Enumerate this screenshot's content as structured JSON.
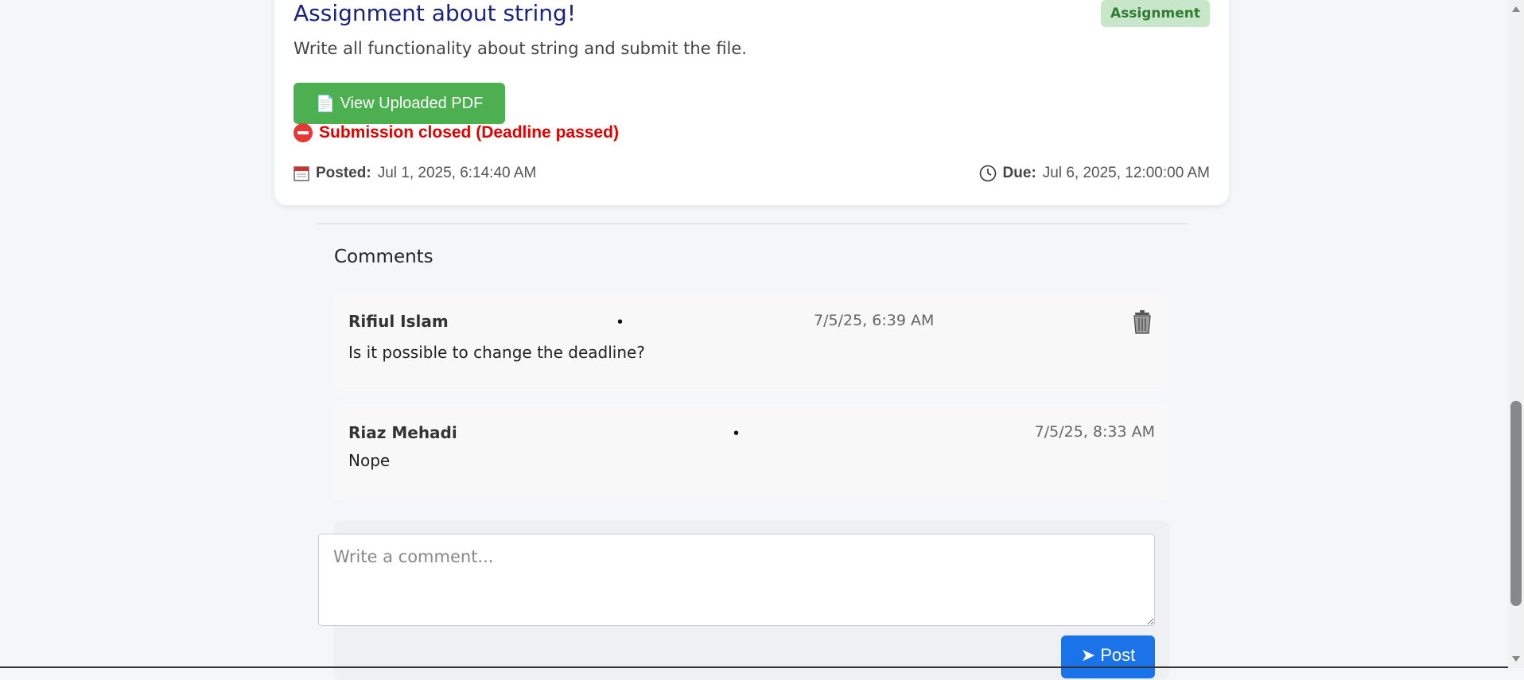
{
  "assignment": {
    "title": "Assignment about string!",
    "badge": "Assignment",
    "description": "Write all functionality about string and submit the file.",
    "pdf_button_label": "View Uploaded PDF",
    "pdf_icon": "📄",
    "closed_text": "Submission closed (Deadline passed)",
    "posted_label": "Posted:",
    "posted_value": "Jul 1, 2025, 6:14:40 AM",
    "due_label": "Due:",
    "due_value": "Jul 6, 2025, 12:00:00 AM"
  },
  "comments": {
    "heading": "Comments",
    "items": [
      {
        "author": "Rifiul Islam",
        "separator": "•",
        "time": "7/5/25, 6:39 AM",
        "text": "Is it possible to change the deadline?"
      },
      {
        "author": "Riaz Mehadi",
        "separator": "•",
        "time": "7/5/25, 8:33 AM",
        "text": "Nope"
      }
    ],
    "input_placeholder": "Write a comment...",
    "post_label": "Post",
    "post_icon": "➤"
  },
  "colors": {
    "title": "#1a237e",
    "badge_bg": "#c8e6c9",
    "pdf_button": "#4caf50",
    "closed_text": "#e00000",
    "post_button": "#1a73e8"
  },
  "icons": {
    "pdf": "document-icon",
    "closed": "no-entry-icon",
    "posted": "calendar-icon",
    "due": "clock-icon",
    "delete": "trash-icon",
    "post": "send-arrow-icon"
  }
}
